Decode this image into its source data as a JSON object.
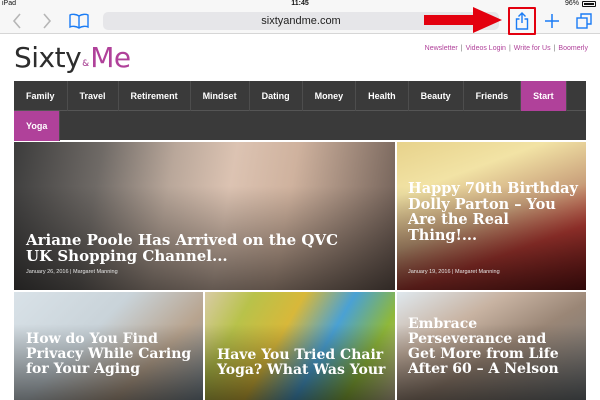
{
  "status_bar": {
    "device": "iPad",
    "time": "11:45",
    "battery": "96%"
  },
  "browser": {
    "url": "sixtyandme.com",
    "icons": {
      "back": "chevron-left-icon",
      "forward": "chevron-right-icon",
      "bookmarks": "book-icon",
      "share": "share-icon",
      "add": "plus-icon",
      "tabs": "tabs-icon"
    },
    "annotation_color": "#e3000f"
  },
  "site": {
    "logo": {
      "part1": "Sixty",
      "part2": "&",
      "part3": "Me"
    },
    "brand_color": "#b0419a",
    "top_links": [
      "Newsletter",
      "Videos Login",
      "Write for Us",
      "Boomerly"
    ],
    "top_link_separator": "|",
    "nav_row1": [
      "Family",
      "Travel",
      "Retirement",
      "Mindset",
      "Dating",
      "Money",
      "Health",
      "Beauty",
      "Friends",
      "Start"
    ],
    "nav_row2": [
      "Yoga"
    ]
  },
  "articles": [
    {
      "title": "Ariane Poole Has Arrived on the QVC UK Shopping Channel...",
      "meta": "January 26, 2016 | Margaret Manning"
    },
    {
      "title": "Happy 70th Birthday Dolly Parton – You Are the Real Thing!...",
      "meta": "January 19, 2016 | Margaret Manning"
    },
    {
      "title": "How do You Find Privacy While Caring for Your Aging",
      "meta": ""
    },
    {
      "title": "Have You Tried Chair Yoga? What Was Your",
      "meta": ""
    },
    {
      "title": "Embrace Perseverance and Get More from Life After 60 – A Nelson",
      "meta": ""
    }
  ]
}
